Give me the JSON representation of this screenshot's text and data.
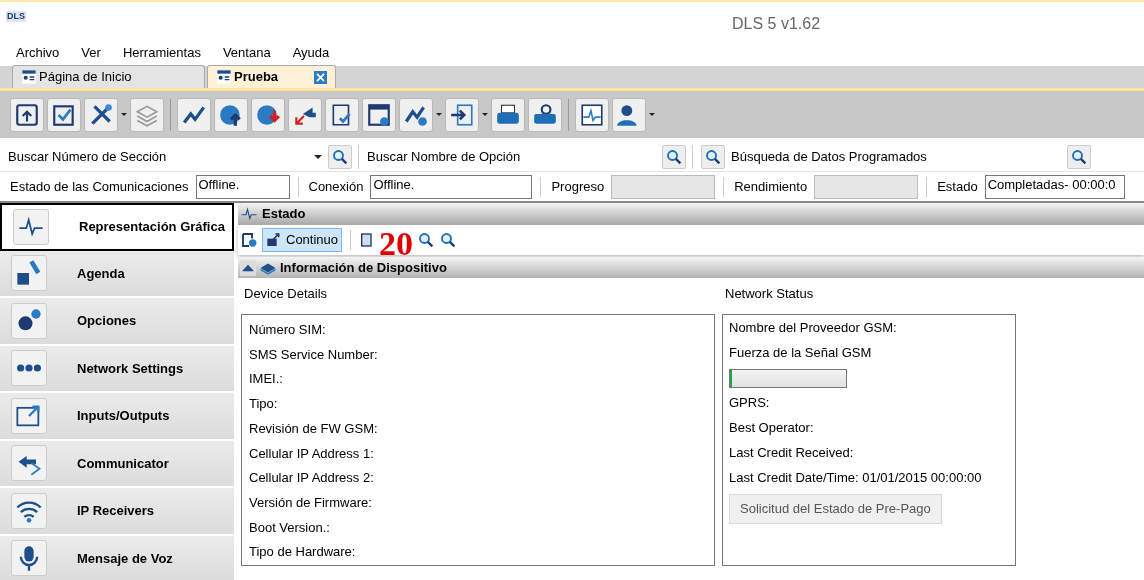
{
  "window": {
    "logo": "DLS",
    "title": "DLS 5 v1.62"
  },
  "menu": [
    "Archivo",
    "Ver",
    "Herramientas",
    "Ventana",
    "Ayuda"
  ],
  "tabs": [
    {
      "label": "Página de Inicio",
      "selected": false,
      "closable": false
    },
    {
      "label": "Prueba",
      "selected": true,
      "closable": true
    }
  ],
  "search_bar": [
    {
      "label": "Buscar Número de Sección",
      "dropdown": true
    },
    {
      "label": "Buscar Nombre de Opción",
      "dropdown": false
    },
    {
      "label": "Búsqueda de Datos Programados",
      "dropdown": false
    }
  ],
  "status_row": [
    {
      "label": "Estado de las Comunicaciones",
      "value": "Offline.",
      "kind": "text"
    },
    {
      "label": "Conexión",
      "value": "Offline.",
      "kind": "text"
    },
    {
      "label": "Progreso",
      "kind": "empty"
    },
    {
      "label": "Rendimiento",
      "kind": "empty"
    },
    {
      "label": "Estado",
      "value": "Completadas- 00:00:0",
      "kind": "text"
    }
  ],
  "sidebar": {
    "items": [
      {
        "label": "Representación Gráfica",
        "selected": true
      },
      {
        "label": "Agenda",
        "selected": false
      },
      {
        "label": "Opciones",
        "selected": false
      },
      {
        "label": "Network Settings",
        "selected": false
      },
      {
        "label": "Inputs/Outputs",
        "selected": false
      },
      {
        "label": "Communicator",
        "selected": false
      },
      {
        "label": "IP Receivers",
        "selected": false
      },
      {
        "label": "Mensaje de Voz",
        "selected": false
      }
    ]
  },
  "panel": {
    "title": "Estado",
    "toolbar": [
      {
        "label": "Continuo",
        "selected": true
      }
    ],
    "annotation": "20",
    "section_title": "Información de Dispositivo",
    "device_details": {
      "title": "Device Details",
      "rows": [
        "Número SIM:",
        "SMS Service Number:",
        "IMEI.:",
        "Tipo:",
        "Revisión de FW GSM:",
        "Cellular IP Address 1:",
        "Cellular IP Address 2:",
        "Versión de Firmware:",
        "Boot Version.:",
        "Tipo de Hardware:"
      ]
    },
    "network_status": {
      "title": "Network Status",
      "rows": [
        {
          "kind": "text",
          "label": "Nombre del Proveedor GSM:"
        },
        {
          "kind": "text",
          "label": "Fuerza de la Señal GSM"
        },
        {
          "kind": "meter",
          "level": 0.01
        },
        {
          "kind": "text",
          "label": "GPRS:"
        },
        {
          "kind": "text",
          "label": "Best Operator:"
        },
        {
          "kind": "text",
          "label": "Last Credit Received:"
        },
        {
          "kind": "text",
          "label": "Last Credit Date/Time: 01/01/2015 00:00:00"
        },
        {
          "kind": "button",
          "label": "Solicitud del Estado de Pre-Pago"
        }
      ]
    }
  }
}
